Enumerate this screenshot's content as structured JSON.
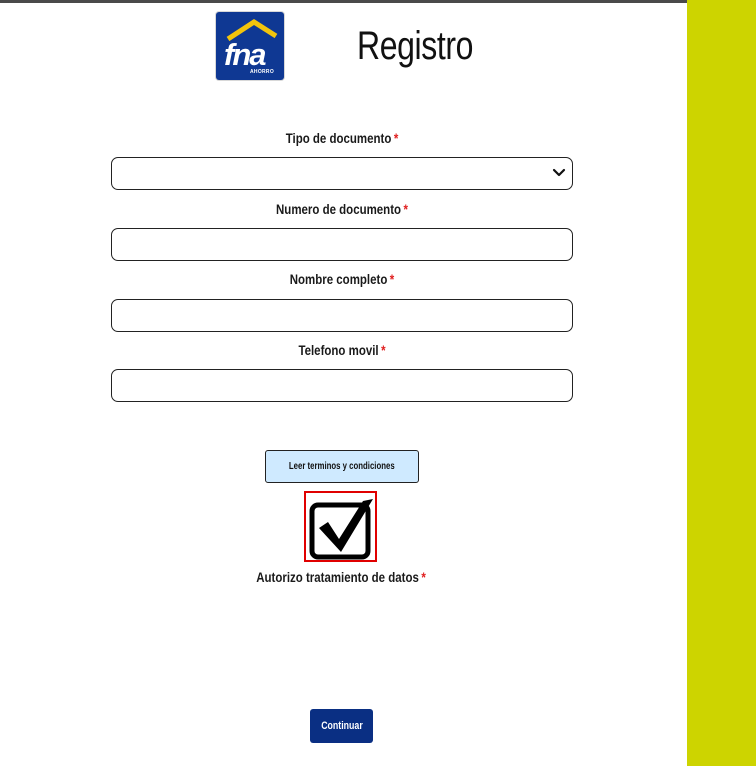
{
  "header": {
    "logo_text": "fna",
    "logo_subtext": "AHORRO",
    "title": "Registro"
  },
  "form": {
    "required_mark": "*",
    "tipo_documento": {
      "label": "Tipo de documento",
      "value": ""
    },
    "numero_documento": {
      "label": "Numero de documento",
      "value": "",
      "placeholder": ""
    },
    "nombre_completo": {
      "label": "Nombre completo",
      "value": "",
      "placeholder": ""
    },
    "telefono_movil": {
      "label": "Telefono movil",
      "value": "",
      "placeholder": ""
    },
    "terms_button_label": "Leer terminos y condiciones",
    "authorize_checked": true,
    "authorize_label": "Autorizo tratamiento de datos",
    "continue_label": "Continuar"
  },
  "colors": {
    "brand_blue": "#0f3893",
    "accent_panel": "#cdd400",
    "required": "#e02020",
    "terms_button_bg": "#cfeaff",
    "checkbox_highlight": "#e00000"
  },
  "icons": {
    "select": "chevron-down-icon",
    "authorize": "checkmark-icon",
    "logo": "house-roof-icon"
  }
}
